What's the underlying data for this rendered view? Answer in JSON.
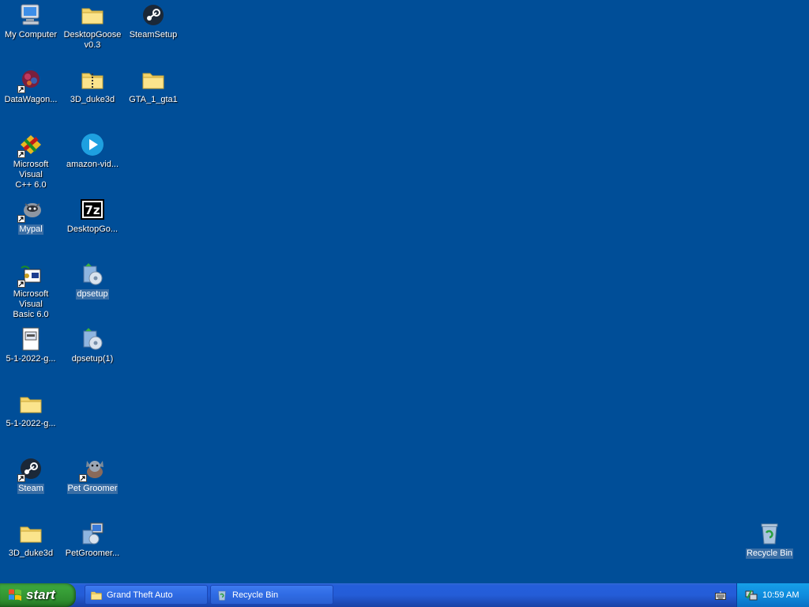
{
  "desktop": {
    "background_color": "#004e98",
    "icons": [
      {
        "label": "My Computer",
        "icon": "my-computer-icon",
        "shortcut": false,
        "selected": false
      },
      {
        "label": "DesktopGoose\nv0.3",
        "icon": "folder-icon",
        "shortcut": false,
        "selected": false
      },
      {
        "label": "SteamSetup",
        "icon": "steam-icon",
        "shortcut": false,
        "selected": false
      },
      {
        "label": "DataWagon...",
        "icon": "datawagon-icon",
        "shortcut": true,
        "selected": false
      },
      {
        "label": "3D_duke3d",
        "icon": "zip-folder-icon",
        "shortcut": false,
        "selected": false
      },
      {
        "label": "GTA_1_gta1",
        "icon": "folder-icon",
        "shortcut": false,
        "selected": false
      },
      {
        "label": "Microsoft Visual\nC++ 6.0",
        "icon": "visual-cpp-icon",
        "shortcut": true,
        "selected": false
      },
      {
        "label": "amazon-vid...",
        "icon": "amazon-video-icon",
        "shortcut": false,
        "selected": false
      },
      {
        "label": "Mypal",
        "icon": "mypal-icon",
        "shortcut": true,
        "selected": true
      },
      {
        "label": "DesktopGo...",
        "icon": "7zip-icon",
        "shortcut": false,
        "selected": false
      },
      {
        "label": "Microsoft Visual\nBasic 6.0",
        "icon": "visual-basic-icon",
        "shortcut": true,
        "selected": false
      },
      {
        "label": "dpsetup",
        "icon": "installer-icon",
        "shortcut": false,
        "selected": true
      },
      {
        "label": "5-1-2022-g...",
        "icon": "document-icon",
        "shortcut": false,
        "selected": false
      },
      {
        "label": "dpsetup(1)",
        "icon": "installer-icon",
        "shortcut": false,
        "selected": false
      },
      {
        "label": "5-1-2022-g...",
        "icon": "folder-icon",
        "shortcut": false,
        "selected": false
      },
      {
        "label": "Steam",
        "icon": "steam-icon",
        "shortcut": true,
        "selected": true
      },
      {
        "label": "Pet Groomer",
        "icon": "pet-groomer-icon",
        "shortcut": true,
        "selected": true
      },
      {
        "label": "3D_duke3d",
        "icon": "folder-icon",
        "shortcut": false,
        "selected": false
      },
      {
        "label": "PetGroomer...",
        "icon": "setup-icon",
        "shortcut": false,
        "selected": false
      },
      {
        "label": "Recycle Bin",
        "icon": "recycle-bin-icon",
        "shortcut": false,
        "selected": true
      }
    ]
  },
  "taskbar": {
    "start_label": "start",
    "tasks": [
      {
        "label": "Grand Theft Auto",
        "icon": "folder-icon"
      },
      {
        "label": "Recycle Bin",
        "icon": "recycle-bin-icon"
      }
    ],
    "clock": "10:59 AM",
    "tray_icons": [
      "keyboard-icon",
      "network-icon"
    ]
  }
}
